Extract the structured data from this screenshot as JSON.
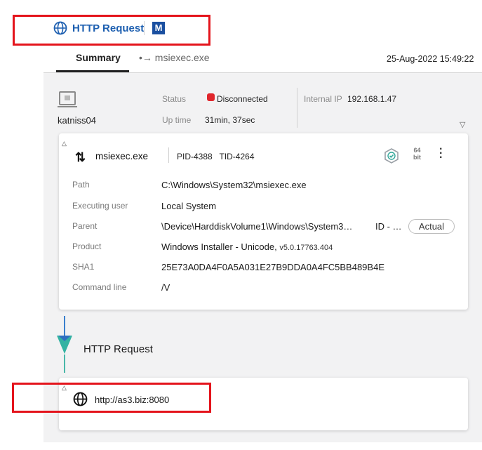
{
  "header": {
    "title": "HTTP Request",
    "logo_letter": "M"
  },
  "tabs": [
    {
      "label": "Summary"
    },
    {
      "label": "•→ msiexec.exe"
    }
  ],
  "timestamp": "25-Aug-2022 15:49:22",
  "host": {
    "name": "katniss04",
    "status_label": "Status",
    "status_value": "Disconnected",
    "uptime_label": "Up time",
    "uptime_value": "31min, 37sec",
    "ip_label": "Internal IP",
    "ip_value": "192.168.1.47"
  },
  "process": {
    "name": "msiexec.exe",
    "pid_tid": "PID-4388   TID-4264",
    "bits_top": "64",
    "bits_bottom": "bit",
    "rows": [
      {
        "label": "Path",
        "value": "C:\\Windows\\System32\\msiexec.exe"
      },
      {
        "label": "Executing user",
        "value": "Local System"
      },
      {
        "label": "Parent",
        "value": "\\Device\\HarddiskVolume1\\Windows\\System3…"
      },
      {
        "label": "Product",
        "value": "Windows Installer - Unicode,",
        "value_extra": "v5.0.17763.404"
      },
      {
        "label": "SHA1",
        "value": "25E73A0DA4F0A5A031E27B9DDA0A4FC5BB489B4E"
      },
      {
        "label": "Command line",
        "value": "/V"
      }
    ],
    "parent_id": "ID - …",
    "actual_button": "Actual"
  },
  "flow": {
    "label": "HTTP Request"
  },
  "network": {
    "url": "http://as3.biz:8080"
  },
  "colors": {
    "accent": "#1d5fb0",
    "status_disconnected": "#e0262c",
    "highlight_box": "#e4141c"
  },
  "icons": [
    "globe-icon",
    "computer-icon",
    "swap-arrows-icon",
    "shield-check-icon",
    "kebab-menu-icon",
    "collapse-triangle-icon"
  ]
}
